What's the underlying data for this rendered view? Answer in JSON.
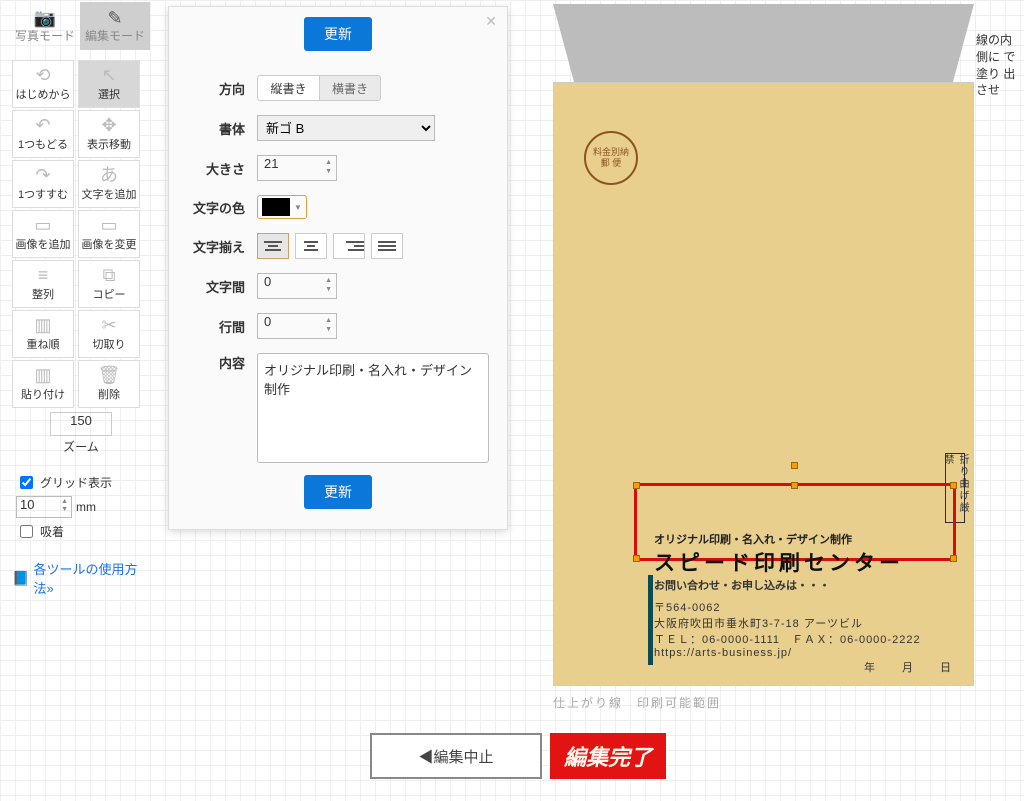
{
  "modes": {
    "photo": "写真モード",
    "edit": "編集モード"
  },
  "tools": {
    "restart": "はじめから",
    "select": "選択",
    "undo": "1つもどる",
    "pan": "表示移動",
    "redo": "1つすすむ",
    "addtext": "文字を追加",
    "addimg": "画像を追加",
    "chgimg": "画像を変更",
    "align": "整列",
    "copy": "コピー",
    "order": "重ね順",
    "cut": "切取り",
    "paste": "貼り付け",
    "delete": "削除"
  },
  "zoom": {
    "value": "150",
    "label": "ズーム"
  },
  "grid": {
    "show_label": "グリッド表示",
    "show_checked": true,
    "unit": "mm",
    "value": "10",
    "snap_label": "吸着",
    "snap_checked": false
  },
  "help_link": "各ツールの使用方法»",
  "dialog": {
    "update": "更新",
    "labels": {
      "direction": "方向",
      "font": "書体",
      "size": "大きさ",
      "color": "文字の色",
      "align": "文字揃え",
      "letter": "文字間",
      "line": "行間",
      "content": "内容"
    },
    "direction": {
      "vertical": "縦書き",
      "horizontal": "横書き",
      "selected": "vertical"
    },
    "font": "新ゴ B",
    "size": "21",
    "color": "#000000",
    "align": "left",
    "letter": "0",
    "line": "0",
    "content": "オリジナル印刷・名入れ・デザイン制作"
  },
  "envelope": {
    "stamp_top": "料金別納",
    "stamp_bot": "郵 便",
    "fold": "折り曲げ厳禁",
    "headline": "オリジナル印刷・名入れ・デザイン制作",
    "title": "スピード印刷センター",
    "subtitle": "お問い合わせ・お申し込みは・・・",
    "postal": "〒564-0062",
    "address": "大阪府吹田市垂水町3-7-18 アーツビル",
    "tel": "ＴＥＬ：06-0000-1111　ＦＡＸ：06-0000-2222",
    "url": "https://arts-business.jp/",
    "date": "年　月　日"
  },
  "canvas_caption": "仕上がり線　印刷可能範囲",
  "side_note": "線の内側に\nで塗り\n出させ",
  "bottom": {
    "cancel": "◀編集中止",
    "done": "編集完了"
  }
}
